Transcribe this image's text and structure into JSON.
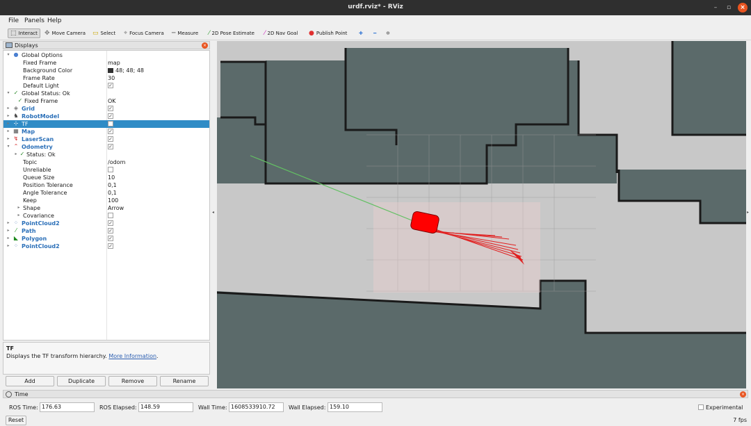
{
  "window": {
    "title": "urdf.rviz* - RViz"
  },
  "menu": [
    "File",
    "Panels",
    "Help"
  ],
  "toolbar": {
    "interact": "Interact",
    "move_camera": "Move Camera",
    "select": "Select",
    "focus_camera": "Focus Camera",
    "measure": "Measure",
    "pose_estimate": "2D Pose Estimate",
    "nav_goal": "2D Nav Goal",
    "publish_point": "Publish Point"
  },
  "displays": {
    "title": "Displays",
    "rows": [
      {
        "name": "Global Options",
        "value": ""
      },
      {
        "name": "Fixed Frame",
        "value": "map"
      },
      {
        "name": "Background Color",
        "value": "48; 48; 48"
      },
      {
        "name": "Frame Rate",
        "value": "30"
      },
      {
        "name": "Default Light",
        "value": ""
      },
      {
        "name": "Global Status: Ok",
        "value": ""
      },
      {
        "name": "Fixed Frame",
        "value": "OK"
      },
      {
        "name": "Grid",
        "value": ""
      },
      {
        "name": "RobotModel",
        "value": ""
      },
      {
        "name": "TF",
        "value": ""
      },
      {
        "name": "Map",
        "value": ""
      },
      {
        "name": "LaserScan",
        "value": ""
      },
      {
        "name": "Odometry",
        "value": ""
      },
      {
        "name": "Status: Ok",
        "value": ""
      },
      {
        "name": "Topic",
        "value": "/odom"
      },
      {
        "name": "Unreliable",
        "value": ""
      },
      {
        "name": "Queue Size",
        "value": "10"
      },
      {
        "name": "Position Tolerance",
        "value": "0,1"
      },
      {
        "name": "Angle Tolerance",
        "value": "0,1"
      },
      {
        "name": "Keep",
        "value": "100"
      },
      {
        "name": "Shape",
        "value": "Arrow"
      },
      {
        "name": "Covariance",
        "value": ""
      },
      {
        "name": "PointCloud2",
        "value": ""
      },
      {
        "name": "Path",
        "value": ""
      },
      {
        "name": "Polygon",
        "value": ""
      },
      {
        "name": "PointCloud2",
        "value": ""
      }
    ],
    "background_color_hex": "#303030",
    "selection_color": "#308cc6",
    "description": {
      "title": "TF",
      "text": "Displays the TF transform hierarchy.",
      "link": "More Information"
    },
    "buttons": {
      "add": "Add",
      "duplicate": "Duplicate",
      "remove": "Remove",
      "rename": "Rename"
    }
  },
  "viewport": {
    "background": "#303030",
    "map_free_color": "#c8c8c8",
    "map_unknown_color": "#5b6a6a",
    "robot_color": "#ff0000",
    "arrow_color": "#e02020"
  },
  "time": {
    "title": "Time",
    "ros_time_label": "ROS Time:",
    "ros_time": "176.63",
    "ros_elapsed_label": "ROS Elapsed:",
    "ros_elapsed": "148.59",
    "wall_time_label": "Wall Time:",
    "wall_time": "1608533910.72",
    "wall_elapsed_label": "Wall Elapsed:",
    "wall_elapsed": "159.10",
    "experimental": "Experimental",
    "reset": "Reset",
    "fps": "7 fps"
  }
}
